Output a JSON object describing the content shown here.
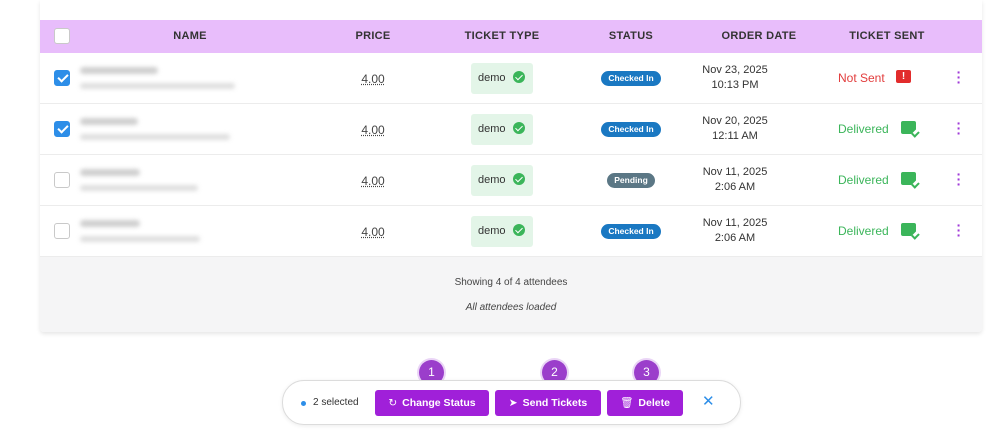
{
  "table": {
    "columns": [
      "NAME",
      "PRICE",
      "TICKET TYPE",
      "STATUS",
      "ORDER DATE",
      "TICKET SENT"
    ],
    "rows": [
      {
        "checked": true,
        "price": "4.00",
        "ticket_type": "demo",
        "status": "Checked In",
        "date": "Nov 23, 2025",
        "time": "10:13 PM",
        "sent": "Not Sent",
        "sent_state": "error"
      },
      {
        "checked": true,
        "price": "4.00",
        "ticket_type": "demo",
        "status": "Checked In",
        "date": "Nov 20, 2025",
        "time": "12:11 AM",
        "sent": "Delivered",
        "sent_state": "ok"
      },
      {
        "checked": false,
        "price": "4.00",
        "ticket_type": "demo",
        "status": "Pending",
        "date": "Nov 11, 2025",
        "time": "2:06 AM",
        "sent": "Delivered",
        "sent_state": "ok"
      },
      {
        "checked": false,
        "price": "4.00",
        "ticket_type": "demo",
        "status": "Checked In",
        "date": "Nov 11, 2025",
        "time": "2:06 AM",
        "sent": "Delivered",
        "sent_state": "ok"
      }
    ]
  },
  "footer": {
    "showing": "Showing 4 of 4 attendees",
    "loaded": "All attendees loaded"
  },
  "bulk_bar": {
    "selected": "2 selected",
    "change_status": "Change Status",
    "send_tickets": "Send Tickets",
    "delete": "Delete",
    "close": "✕"
  },
  "markers": [
    "1",
    "2",
    "3"
  ],
  "colors": {
    "header_bg": "#e8bdfb",
    "accent": "#a020d9",
    "checked_in": "#1a78c2",
    "pending": "#5b7785",
    "delivered": "#3bb55a",
    "not_sent": "#e23c3c"
  }
}
